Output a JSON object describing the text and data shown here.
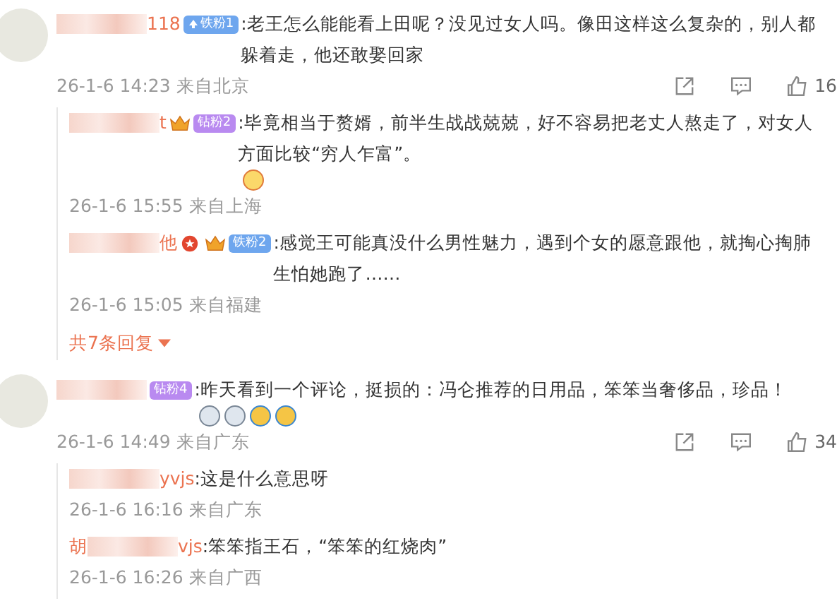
{
  "comments": [
    {
      "name": "118",
      "badge": {
        "label": "铁粉1",
        "kind": "arrow",
        "color": "#6ea6ee"
      },
      "text": ":老王怎么能能看上田呢？没见过女人吗。像田这样这么复杂的，别人都躲着走，他还敢娶回家",
      "time": "26-1-6 14:23",
      "location": "来自北京",
      "likes": "16",
      "replies": [
        {
          "name": "t",
          "verified": false,
          "badge": {
            "label": "钻粉2",
            "kind": "crown",
            "color": "#b98af0"
          },
          "text": ":毕竟相当于赘婿，前半生战战兢兢，好不容易把老丈人熬走了，对女人方面比较“穷人乍富”。",
          "emojis": [
            {
              "kind": "yum"
            }
          ],
          "time": "26-1-6 15:55",
          "location": "来自上海"
        },
        {
          "name": "他",
          "verified": true,
          "badge": {
            "label": "铁粉2",
            "kind": "crown",
            "color": "#6ea6ee"
          },
          "text": ":感觉王可能真没什么男性魅力，遇到个女的愿意跟他，就掏心掏肺生怕她跑了……",
          "time": "26-1-6 15:05",
          "location": "来自福建"
        }
      ],
      "more_replies": "共7条回复"
    },
    {
      "badge": {
        "label": "钻粉4",
        "kind": "plain",
        "color": "#b98af0"
      },
      "text": ":昨天看到一个评论，挺损的：冯仑推荐的日用品，笨笨当奢侈品，珍品！",
      "emojis": [
        {
          "kind": "shock"
        },
        {
          "kind": "shock"
        },
        {
          "kind": "laugh"
        },
        {
          "kind": "laugh"
        }
      ],
      "time": "26-1-6 14:49",
      "location": "来自广东",
      "likes": "34",
      "replies": [
        {
          "name": "yvjs",
          "verified": false,
          "text": ":这是什么意思呀",
          "time": "26-1-6 16:16",
          "location": "来自广东"
        },
        {
          "name_start": "胡",
          "name": "vjs",
          "verified": false,
          "text": ":笨笨指王石，“笨笨的红烧肉”",
          "time": "26-1-6 16:26",
          "location": "来自广西"
        }
      ]
    }
  ]
}
